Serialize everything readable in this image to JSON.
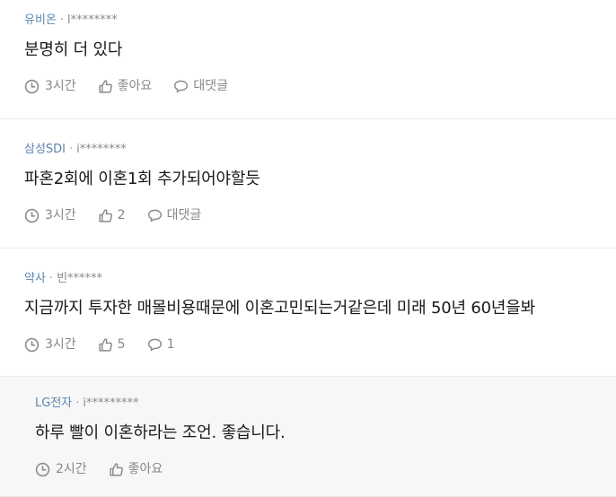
{
  "comments": [
    {
      "company": "유비온",
      "user": "l********",
      "text": "분명히 더 있다",
      "time": "3시간",
      "likes": "좋아요",
      "replies": "대댓글"
    },
    {
      "company": "삼성SDI",
      "user": "i********",
      "text": "파혼2회에 이혼1회 추가되어야할듯",
      "time": "3시간",
      "likes": "2",
      "replies": "대댓글"
    },
    {
      "company": "약사",
      "user": "빈******",
      "text": "지금까지 투자한 매몰비용때문에 이혼고민되는거같은데 미래 50년 60년을봐",
      "time": "3시간",
      "likes": "5",
      "replies": "1"
    },
    {
      "company": "LG전자",
      "user": "i*********",
      "text": "하루 빨이 이혼하라는 조언. 좋습니다.",
      "time": "2시간",
      "likes": "좋아요"
    }
  ],
  "separator": "·"
}
